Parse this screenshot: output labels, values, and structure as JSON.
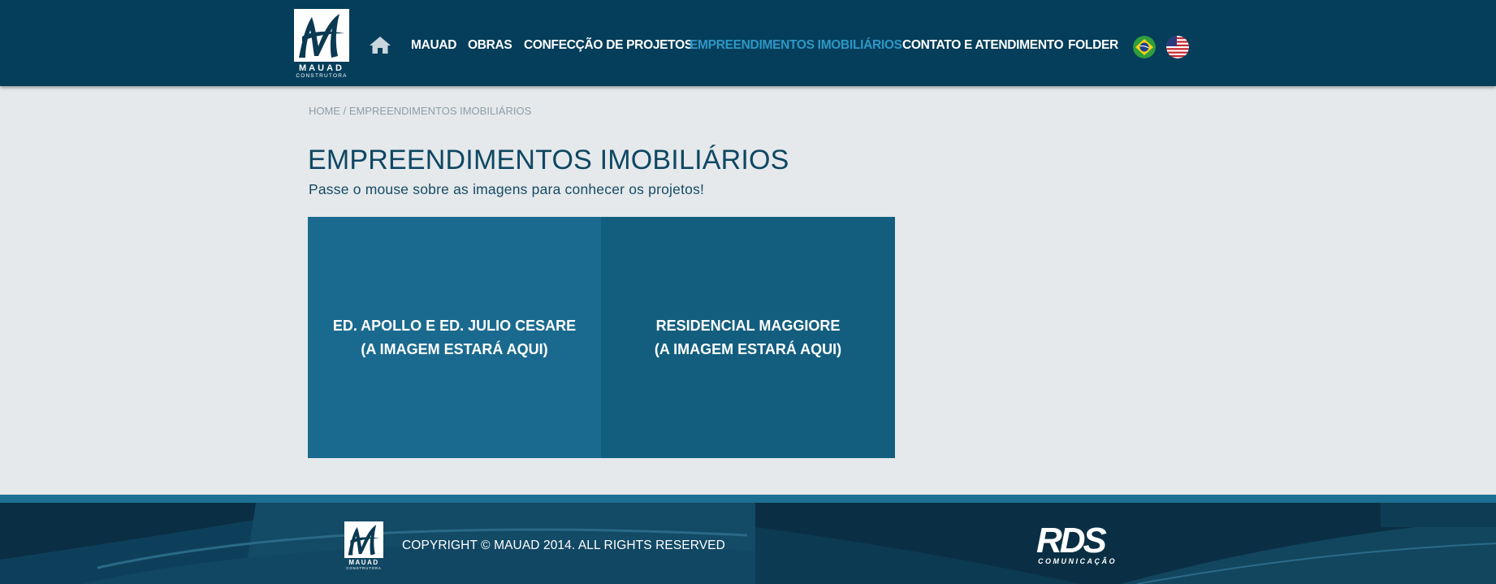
{
  "header": {
    "logo": {
      "name": "MAUAD",
      "sub": "CONSTRUTORA"
    },
    "nav": [
      {
        "label": "MAUAD",
        "active": false
      },
      {
        "label": "OBRAS",
        "active": false
      },
      {
        "label": "CONFECÇÃO DE PROJETOS",
        "active": false
      },
      {
        "label": "EMPREENDIMENTOS IMOBILIÁRIOS",
        "active": true
      },
      {
        "label": "CONTATO E ATENDIMENTO",
        "active": false
      },
      {
        "label": "FOLDER",
        "active": false
      }
    ],
    "flags": [
      "brazil-flag-icon",
      "usa-flag-icon"
    ]
  },
  "breadcrumb": "HOME / EMPREENDIMENTOS IMOBILIÁRIOS",
  "main": {
    "title": "EMPREENDIMENTOS IMOBILIÁRIOS",
    "subtitle": "Passe o mouse sobre as imagens para conhecer os projetos!",
    "projects": [
      {
        "line1": "ED. APOLLO E ED. JULIO CESARE",
        "line2": "(A IMAGEM ESTARÁ AQUI)"
      },
      {
        "line1": "RESIDENCIAL MAGGIORE",
        "line2": "(A IMAGEM ESTARÁ AQUI)"
      }
    ]
  },
  "footer": {
    "logo": {
      "name": "MAUAD",
      "sub": "CONSTRUTORA"
    },
    "copyright": "COPYRIGHT © MAUAD 2014. ALL RIGHTS RESERVED",
    "agency": {
      "name": "RDS",
      "sub": "COMUNICAÇÃO"
    }
  },
  "colors": {
    "header_bg": "#043e5a",
    "nav_active": "#2e97c6",
    "page_bg": "#e5e9ec",
    "card_1": "#1a6a8f",
    "card_2": "#135e7f",
    "footer_bg": "#0a2f44"
  }
}
